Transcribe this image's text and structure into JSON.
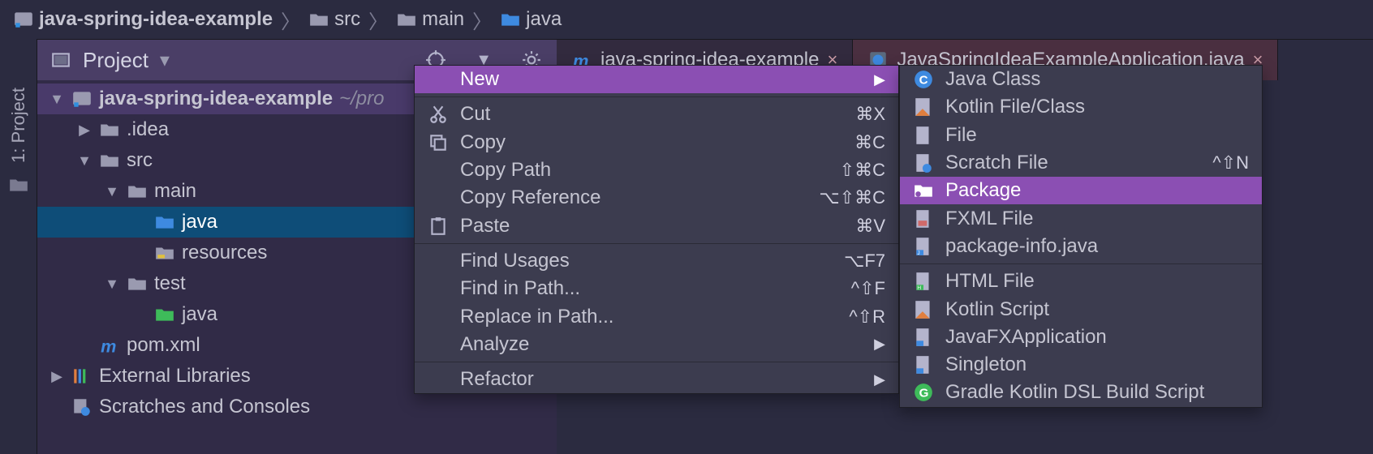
{
  "breadcrumb": [
    {
      "icon": "project-icon",
      "label": "java-spring-idea-example",
      "bold": true
    },
    {
      "icon": "folder-icon",
      "label": "src"
    },
    {
      "icon": "folder-icon",
      "label": "main"
    },
    {
      "icon": "source-folder-icon",
      "label": "java"
    }
  ],
  "side_tool": {
    "label": "1: Project"
  },
  "project_panel": {
    "title": "Project",
    "tree": {
      "root": {
        "label": "java-spring-idea-example",
        "path_hint": "~/pro"
      },
      "items": [
        {
          "label": ".idea",
          "icon": "folder-icon",
          "expanded": false
        },
        {
          "label": "src",
          "icon": "folder-icon",
          "expanded": true
        },
        {
          "label": "main",
          "icon": "folder-icon",
          "expanded": true
        },
        {
          "label": "java",
          "icon": "source-folder-icon",
          "selected": true
        },
        {
          "label": "resources",
          "icon": "resources-folder-icon"
        },
        {
          "label": "test",
          "icon": "folder-icon",
          "expanded": true
        },
        {
          "label": "java",
          "icon": "test-folder-icon"
        },
        {
          "label": "pom.xml",
          "icon": "maven-icon"
        },
        {
          "label": "External Libraries",
          "icon": "libraries-icon",
          "expanded": false
        },
        {
          "label": "Scratches and Consoles",
          "icon": "scratches-icon"
        }
      ]
    }
  },
  "editor_tabs": [
    {
      "label": "java-spring-idea-example",
      "icon": "maven-icon",
      "active": false
    },
    {
      "label": "JavaSpringIdeaExampleApplication.java",
      "icon": "java-class-icon",
      "active": true
    }
  ],
  "context_menu": {
    "items": [
      {
        "label": "New",
        "submenu": true,
        "highlight": true
      },
      {
        "separator": true
      },
      {
        "icon": "cut-icon",
        "label": "Cut",
        "shortcut": "⌘X"
      },
      {
        "icon": "copy-icon",
        "label": "Copy",
        "shortcut": "⌘C"
      },
      {
        "label": "Copy Path",
        "shortcut": "⇧⌘C"
      },
      {
        "label": "Copy Reference",
        "shortcut": "⌥⇧⌘C"
      },
      {
        "icon": "paste-icon",
        "label": "Paste",
        "shortcut": "⌘V"
      },
      {
        "separator": true
      },
      {
        "label": "Find Usages",
        "shortcut": "⌥F7"
      },
      {
        "label": "Find in Path...",
        "shortcut": "^⇧F"
      },
      {
        "label": "Replace in Path...",
        "shortcut": "^⇧R"
      },
      {
        "label": "Analyze",
        "submenu": true
      },
      {
        "separator": true
      },
      {
        "label": "Refactor",
        "submenu": true,
        "cut": true
      }
    ]
  },
  "new_submenu": {
    "items": [
      {
        "icon": "java-class-icon",
        "label": "Java Class"
      },
      {
        "icon": "kotlin-file-icon",
        "label": "Kotlin File/Class"
      },
      {
        "icon": "file-icon",
        "label": "File"
      },
      {
        "icon": "scratch-file-icon",
        "label": "Scratch File",
        "shortcut": "^⇧N"
      },
      {
        "icon": "package-icon",
        "label": "Package",
        "highlight": true
      },
      {
        "icon": "fxml-icon",
        "label": "FXML File"
      },
      {
        "icon": "java-file-icon",
        "label": "package-info.java"
      },
      {
        "separator": true
      },
      {
        "icon": "html-icon",
        "label": "HTML File"
      },
      {
        "icon": "kotlin-script-icon",
        "label": "Kotlin Script"
      },
      {
        "icon": "java-file-icon",
        "label": "JavaFXApplication"
      },
      {
        "icon": "java-file-icon",
        "label": "Singleton"
      },
      {
        "icon": "gradle-icon",
        "label": "Gradle Kotlin DSL Build Script"
      }
    ]
  },
  "colors": {
    "highlight_purple": "#8b4fb3",
    "selection_blue": "#0e4d78",
    "panel_purple": "#4a3e66"
  }
}
